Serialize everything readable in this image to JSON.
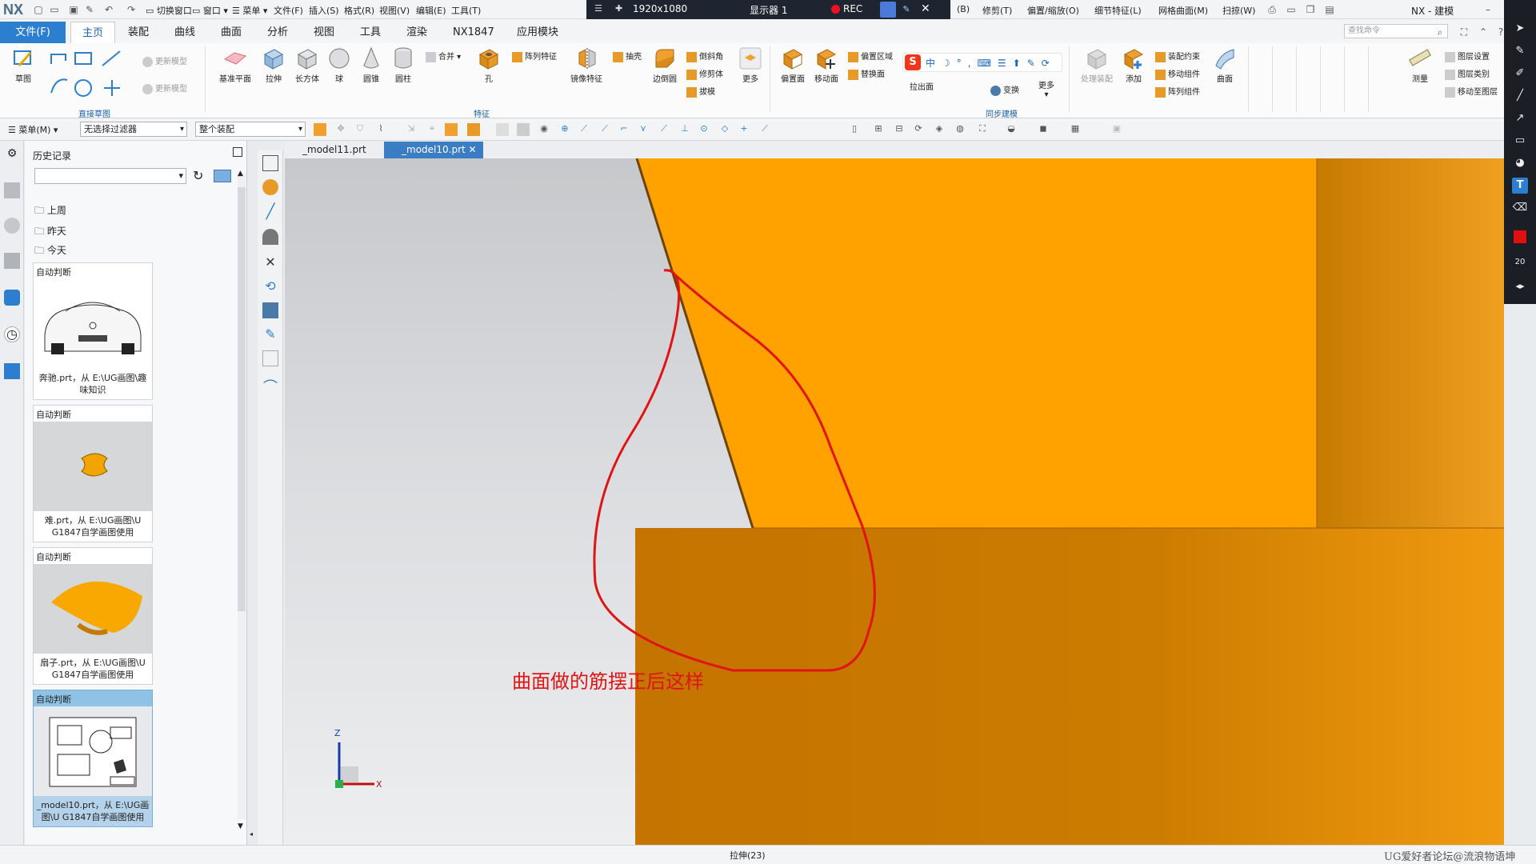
{
  "titlebar": {
    "logo": "NX",
    "quick_items": [
      "切换窗口",
      "窗口",
      "菜单"
    ],
    "menus": [
      "文件(F)",
      "插入(S)",
      "格式(R)",
      "视图(V)",
      "编辑(E)",
      "工具(T)"
    ],
    "menus_right": [
      "(B)",
      "修剪(T)",
      "偏置/缩放(O)",
      "细节特征(L)",
      "网格曲面(M)",
      "扫掠(W)"
    ],
    "app_title": "NX - 建模"
  },
  "recorder": {
    "resolution": "1920x1080",
    "display": "显示器 1",
    "rec": "REC"
  },
  "tabs": {
    "file": "文件(F)",
    "items": [
      "主页",
      "装配",
      "曲线",
      "曲面",
      "分析",
      "视图",
      "工具",
      "渲染",
      "NX1847",
      "应用模块"
    ],
    "search_placeholder": "查找命令"
  },
  "ribbon": {
    "sketch": "草图",
    "update_model_1": "更新模型",
    "update_model_2": "更新模型",
    "group_direct_sketch": "直接草图",
    "datum_plane": "基准平面",
    "extrude": "拉伸",
    "block": "长方体",
    "sphere": "球",
    "cone": "圆锥",
    "cylinder": "圆柱",
    "unite": "合并",
    "hole": "孔",
    "pattern_feature": "阵列特征",
    "mirror_feature": "镜像特征",
    "shell": "抽壳",
    "edge_blend": "边倒圆",
    "chamfer": "倒斜角",
    "trim_body": "修剪体",
    "draft": "拔模",
    "more_1": "更多",
    "group_feature": "特征",
    "offset_face": "偏置面",
    "move_face": "移动面",
    "offset_region": "偏置区域",
    "replace_face": "替换面",
    "pull_face": "拉出面",
    "transform": "变换",
    "more_2": "更多",
    "group_sync": "同步建模",
    "process_assembly": "处理装配",
    "add": "添加",
    "assembly_constraint": "装配约束",
    "move_component": "移动组件",
    "pattern_component": "阵列组件",
    "surface": "曲面",
    "measure": "测量",
    "layer_settings": "图层设置",
    "layer_category": "图层类别",
    "move_to_layer": "移动至图层"
  },
  "toolbar2": {
    "menu": "菜单(M)",
    "filter": "无选择过滤器",
    "assembly_scope": "整个装配"
  },
  "history": {
    "title": "历史记录",
    "folders": [
      "上周",
      "昨天",
      "今天"
    ],
    "cards": [
      {
        "header": "自动判断",
        "caption": "奔驰.prt，从 E:\\UG画图\\趣味知识"
      },
      {
        "header": "自动判断",
        "caption": "难.prt，从 E:\\UG画图\\U G1847自学画图使用"
      },
      {
        "header": "自动判断",
        "caption": "扇子.prt，从 E:\\UG画图\\U G1847自学画图使用"
      },
      {
        "header": "自动判断",
        "caption": "_model10.prt，从 E:\\UG画图\\U G1847自学画图使用"
      }
    ]
  },
  "doc_tabs": [
    "_model11.prt",
    "_model10.prt"
  ],
  "viewport": {
    "annotation": "曲面做的筋摆正后这样",
    "axis_z": "Z",
    "axis_x": "X"
  },
  "right_toolbar": {
    "size": "20",
    "pen_color": "#e01010"
  },
  "status": {
    "text": "拉伸(23)",
    "watermark": "UG爱好者论坛@流浪物语坤"
  },
  "colors": {
    "accent": "#2b7fce",
    "model_orange": "#ffa000",
    "model_dark": "#c87800",
    "annotation_red": "#e01414"
  }
}
